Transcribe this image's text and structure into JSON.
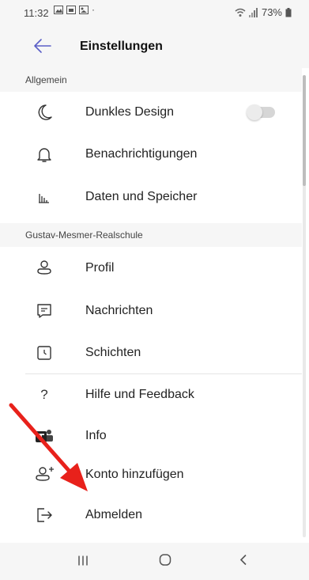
{
  "status": {
    "time": "11:32",
    "battery": "73%"
  },
  "header": {
    "title": "Einstellungen"
  },
  "sections": [
    {
      "title": "Allgemein",
      "items": [
        {
          "label": "Dunkles Design",
          "icon": "moon-icon",
          "toggle": false
        },
        {
          "label": "Benachrichtigungen",
          "icon": "bell-icon"
        },
        {
          "label": "Daten und Speicher",
          "icon": "bar-chart-icon"
        }
      ]
    },
    {
      "title": "Gustav-Mesmer-Realschule",
      "items": [
        {
          "label": "Profil",
          "icon": "person-icon"
        },
        {
          "label": "Nachrichten",
          "icon": "message-icon"
        },
        {
          "label": "Schichten",
          "icon": "clock-icon"
        }
      ]
    },
    {
      "items": [
        {
          "label": "Hilfe und Feedback",
          "icon": "question-icon"
        },
        {
          "label": "Info",
          "icon": "teams-logo-icon"
        },
        {
          "label": "Konto hinzufügen",
          "icon": "add-account-icon"
        },
        {
          "label": "Abmelden",
          "icon": "sign-out-icon"
        }
      ]
    }
  ],
  "annotation": {
    "color": "#e8211b"
  },
  "colors": {
    "accent": "#5b5fc7",
    "background": "#ffffff",
    "header_bg": "#f6f6f6"
  }
}
